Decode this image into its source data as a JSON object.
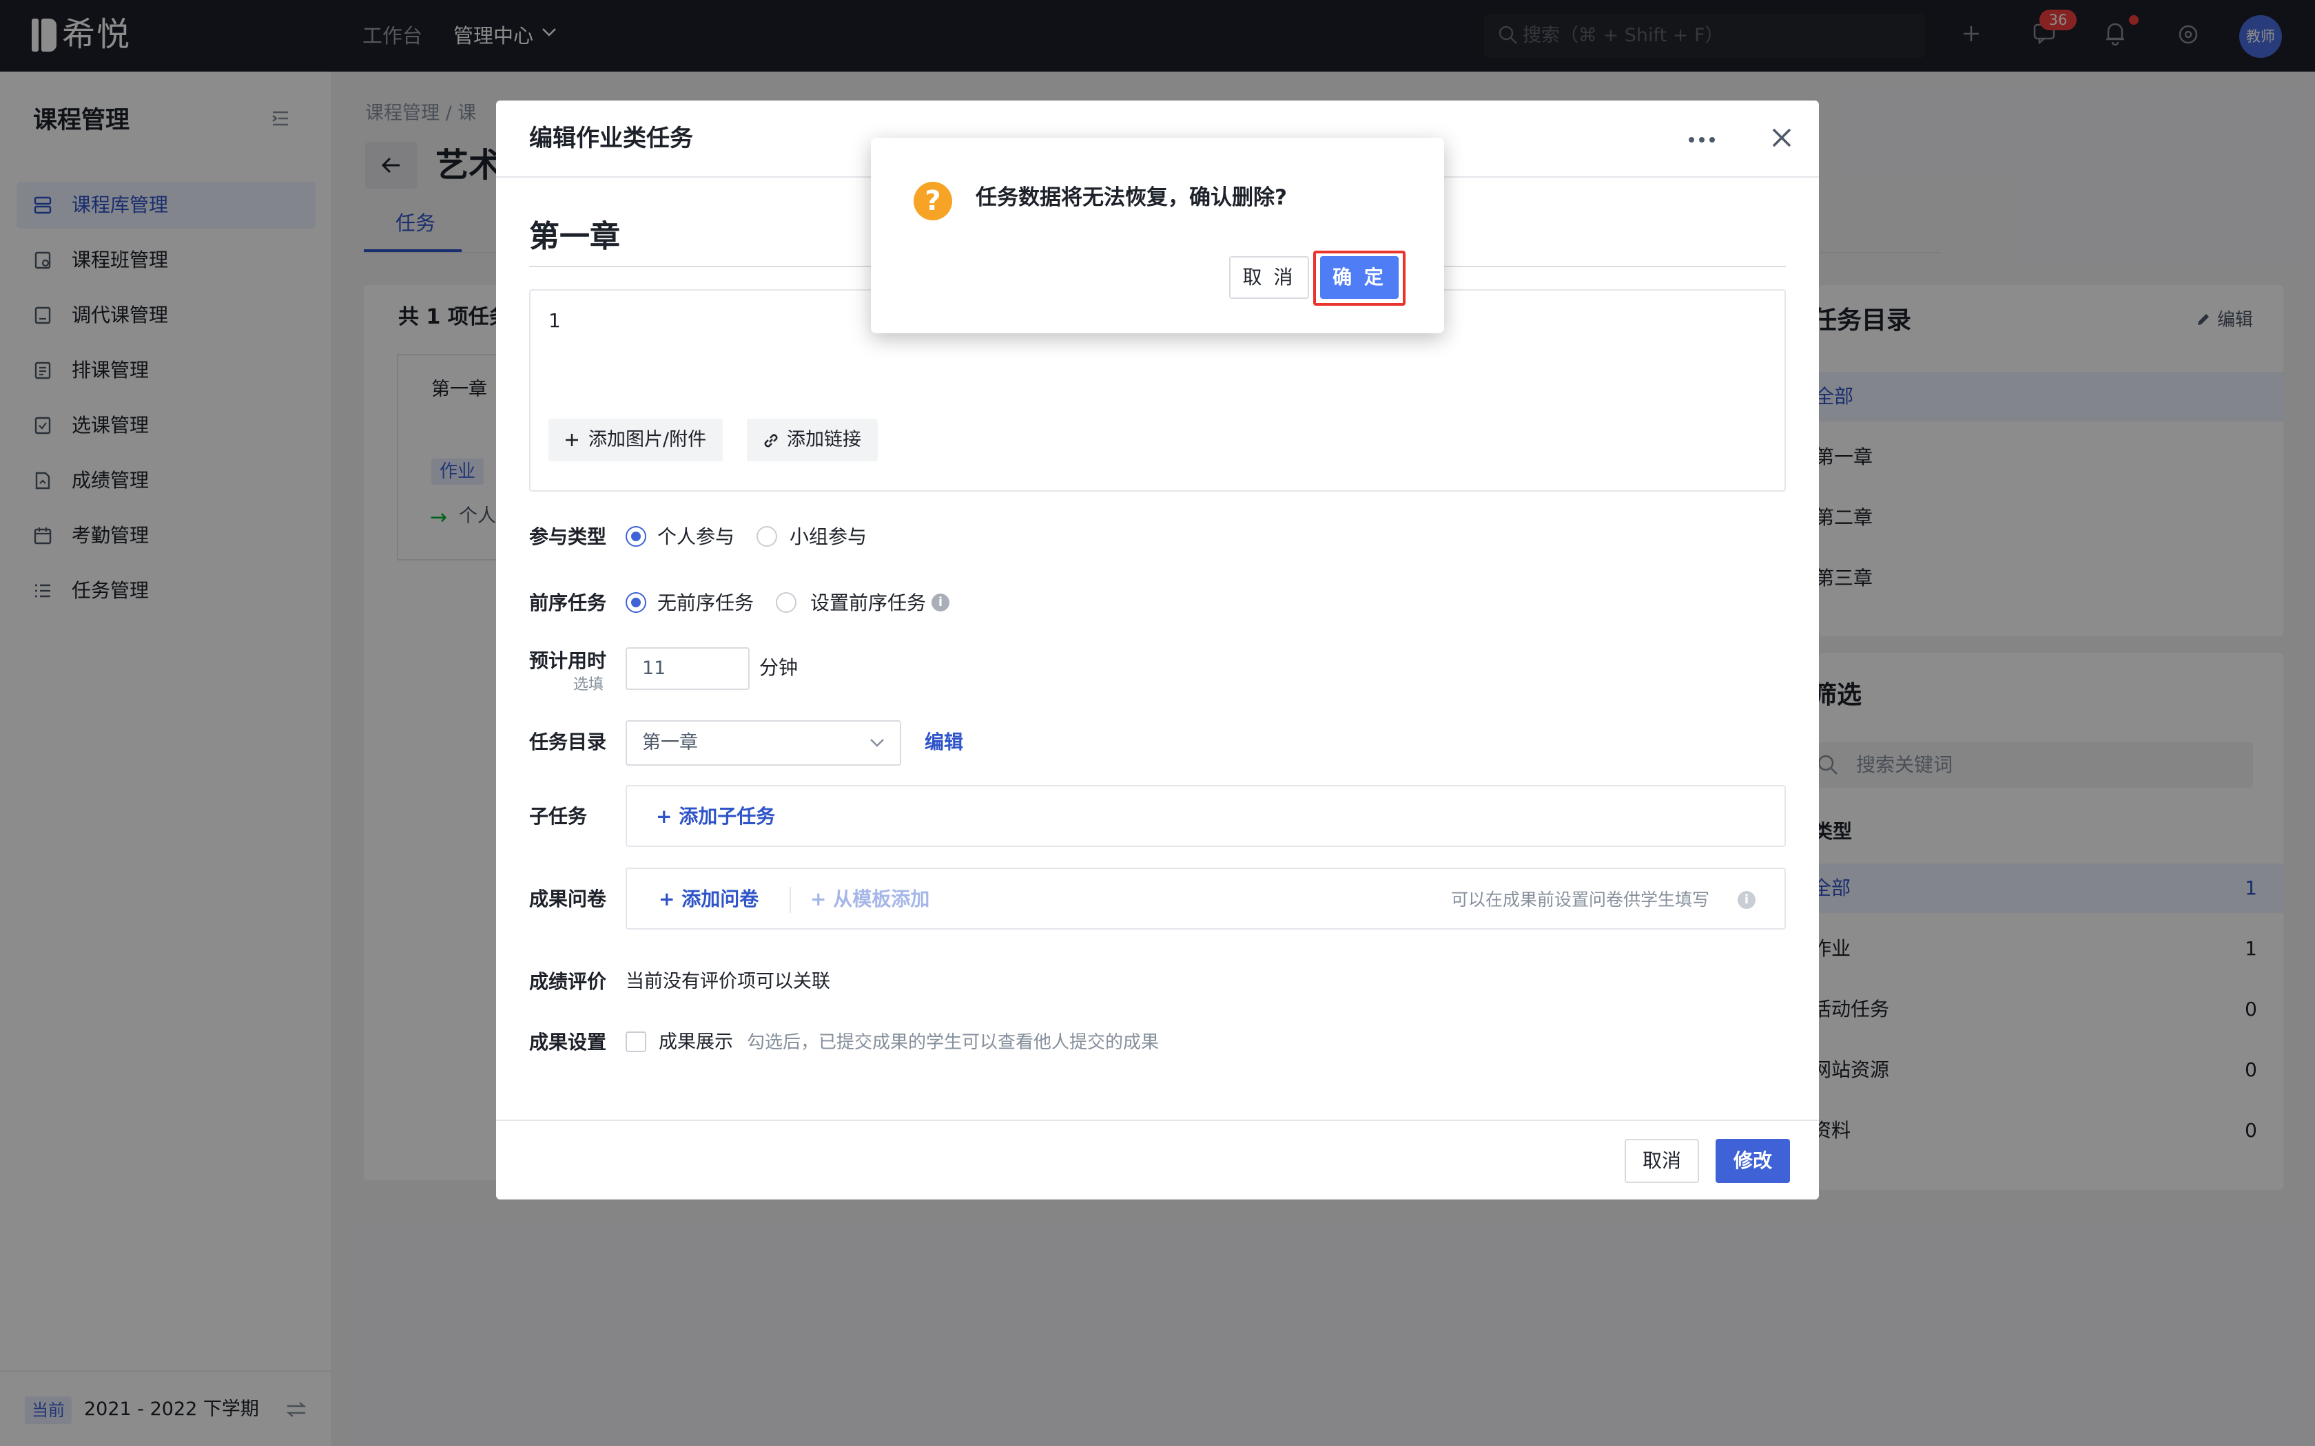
{
  "header": {
    "logo_text": "希悦",
    "nav": {
      "workbench": "工作台",
      "admin_center": "管理中心"
    },
    "search_placeholder": "搜索（⌘ + Shift + F）",
    "message_badge": "36",
    "avatar_text": "教师"
  },
  "sidebar": {
    "title": "课程管理",
    "items": [
      {
        "label": "课程库管理",
        "icon": "course-library-icon",
        "active": true
      },
      {
        "label": "课程班管理",
        "icon": "class-icon",
        "active": false
      },
      {
        "label": "调代课管理",
        "icon": "substitute-icon",
        "active": false
      },
      {
        "label": "排课管理",
        "icon": "schedule-icon",
        "active": false
      },
      {
        "label": "选课管理",
        "icon": "selection-icon",
        "active": false
      },
      {
        "label": "成绩管理",
        "icon": "grade-icon",
        "active": false
      },
      {
        "label": "考勤管理",
        "icon": "attendance-icon",
        "active": false
      },
      {
        "label": "任务管理",
        "icon": "task-list-icon",
        "active": false
      }
    ],
    "footer": {
      "badge": "当前",
      "term": "2021 - 2022 下学期"
    }
  },
  "background": {
    "breadcrumb": "课程管理  /  课",
    "page_title": "艺术",
    "tab_task": "任务",
    "task_count": "共 1 项任务",
    "chapter_label": "第一章",
    "homework_tag": "作业",
    "personal_text": "个人",
    "task_directory": {
      "title": "任务目录",
      "edit_label": "编辑",
      "items": [
        "全部",
        "第一章",
        "第二章",
        "第三章"
      ]
    },
    "filter": {
      "title": "筛选",
      "search_placeholder": "搜索关键词",
      "type_label": "类型",
      "rows": [
        {
          "label": "全部",
          "count": "1"
        },
        {
          "label": "作业",
          "count": "1"
        },
        {
          "label": "活动任务",
          "count": "0"
        },
        {
          "label": "网站资源",
          "count": "0"
        },
        {
          "label": "资料",
          "count": "0"
        }
      ]
    }
  },
  "edit_modal": {
    "title": "编辑作业类任务",
    "chapter_heading": "第一章",
    "description": "1",
    "add_image_label": "添加图片/附件",
    "add_link_label": "添加链接",
    "participation": {
      "label": "参与类型",
      "options": [
        "个人参与",
        "小组参与"
      ],
      "selected": "个人参与"
    },
    "prerequisite": {
      "label": "前序任务",
      "options": [
        "无前序任务",
        "设置前序任务"
      ],
      "selected": "无前序任务"
    },
    "estimated_time": {
      "label": "预计用时",
      "sublabel": "选填",
      "value": "11",
      "unit": "分钟"
    },
    "directory": {
      "label": "任务目录",
      "value": "第一章",
      "edit_label": "编辑"
    },
    "subtask": {
      "label": "子任务",
      "add_label": "添加子任务"
    },
    "survey": {
      "label": "成果问卷",
      "add_label": "添加问卷",
      "template_label": "从模板添加",
      "hint": "可以在成果前设置问卷供学生填写"
    },
    "grading": {
      "label": "成绩评价",
      "text": "当前没有评价项可以关联"
    },
    "outcome": {
      "label": "成果设置",
      "checkbox_label": "成果展示",
      "checked": false,
      "hint": "勾选后，已提交成果的学生可以查看他人提交的成果"
    },
    "cancel_label": "取消",
    "submit_label": "修改"
  },
  "confirm_dialog": {
    "message": "任务数据将无法恢复，确认删除?",
    "cancel_label": "取 消",
    "ok_label": "确 定"
  },
  "colors": {
    "header_bg": "#1d2029",
    "accent": "#3f63d6",
    "confirm_ok": "#4e7df6",
    "warning_icon": "#f7a325",
    "highlight_frame": "#e8342b",
    "badge_red": "#f53f3f"
  }
}
